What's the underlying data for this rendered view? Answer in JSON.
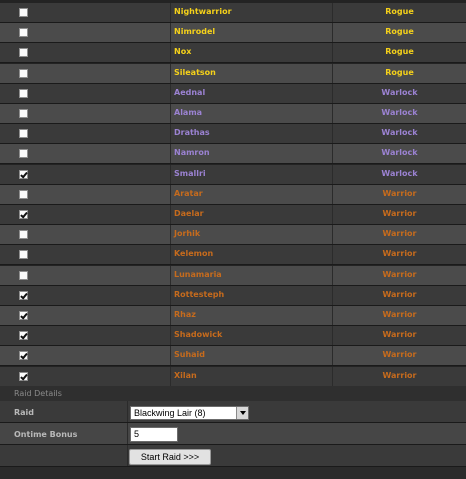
{
  "colors": {
    "Rogue": "#f5d11a",
    "Warlock": "#9b82d2",
    "Warrior": "#c66b1d"
  },
  "roster": [
    {
      "name": "Nightwarrior",
      "class": "Rogue",
      "checked": false
    },
    {
      "name": "Nimrodel",
      "class": "Rogue",
      "checked": false
    },
    {
      "name": "Nox",
      "class": "Rogue",
      "checked": false
    },
    {
      "name": "Sileatson",
      "class": "Rogue",
      "checked": false
    },
    {
      "name": "Aednal",
      "class": "Warlock",
      "checked": false
    },
    {
      "name": "Alama",
      "class": "Warlock",
      "checked": false
    },
    {
      "name": "Drathas",
      "class": "Warlock",
      "checked": false
    },
    {
      "name": "Namron",
      "class": "Warlock",
      "checked": false
    },
    {
      "name": "Smallri",
      "class": "Warlock",
      "checked": true
    },
    {
      "name": "Aratar",
      "class": "Warrior",
      "checked": false
    },
    {
      "name": "Daelar",
      "class": "Warrior",
      "checked": true
    },
    {
      "name": "Jorhik",
      "class": "Warrior",
      "checked": false
    },
    {
      "name": "Kelemon",
      "class": "Warrior",
      "checked": false
    },
    {
      "name": "Lunamaria",
      "class": "Warrior",
      "checked": false
    },
    {
      "name": "Rottesteph",
      "class": "Warrior",
      "checked": true
    },
    {
      "name": "Rhaz",
      "class": "Warrior",
      "checked": true
    },
    {
      "name": "Shadowick",
      "class": "Warrior",
      "checked": true
    },
    {
      "name": "Suhaid",
      "class": "Warrior",
      "checked": true
    },
    {
      "name": "Xilan",
      "class": "Warrior",
      "checked": true
    }
  ],
  "raid_details": {
    "section_title": "Raid Details",
    "raid_label": "Raid",
    "raid_value": "Blackwing Lair (8)",
    "ontime_label": "Ontime Bonus",
    "ontime_value": "5",
    "start_button": "Start Raid >>>"
  }
}
